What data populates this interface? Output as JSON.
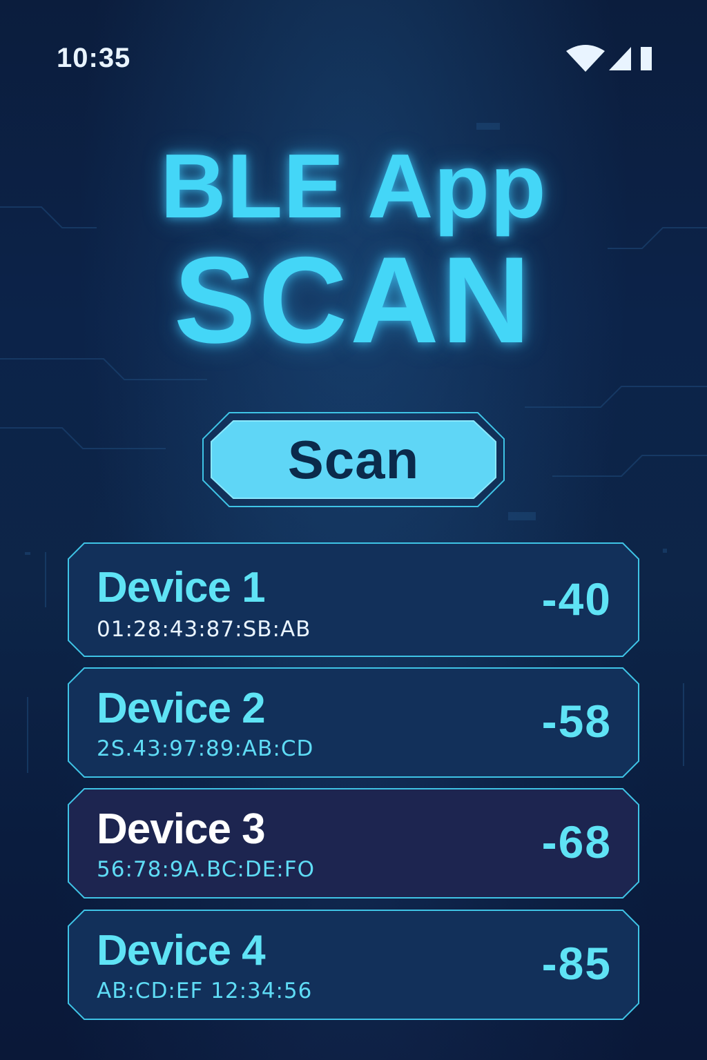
{
  "status_bar": {
    "time": "10:35",
    "icons": [
      "wifi-icon",
      "signal-icon",
      "battery-icon"
    ]
  },
  "header": {
    "title": "BLE App",
    "subtitle": "SCAN"
  },
  "scan_button": {
    "label": "Scan"
  },
  "devices": [
    {
      "name": "Device 1",
      "mac": "01:28:43:87:SB:AB",
      "rssi": "-40",
      "selected": false
    },
    {
      "name": "Device 2",
      "mac": "2S.43:97:89:AB:CD",
      "rssi": "-58",
      "selected": false
    },
    {
      "name": "Device 3",
      "mac": "56:78:9A.BC:DE:FO",
      "rssi": "-68",
      "selected": true
    },
    {
      "name": "Device 4",
      "mac": "AB:CD:EF 12:34:56",
      "rssi": "-85",
      "selected": false
    }
  ],
  "colors": {
    "background": "#0c2349",
    "accent": "#44d6f7",
    "card_border": "#3fc4e6",
    "card_fill": "#12305a",
    "selected_card_fill": "#1d2550",
    "button_fill": "#5fd6f6",
    "button_text": "#0b2a4b"
  }
}
